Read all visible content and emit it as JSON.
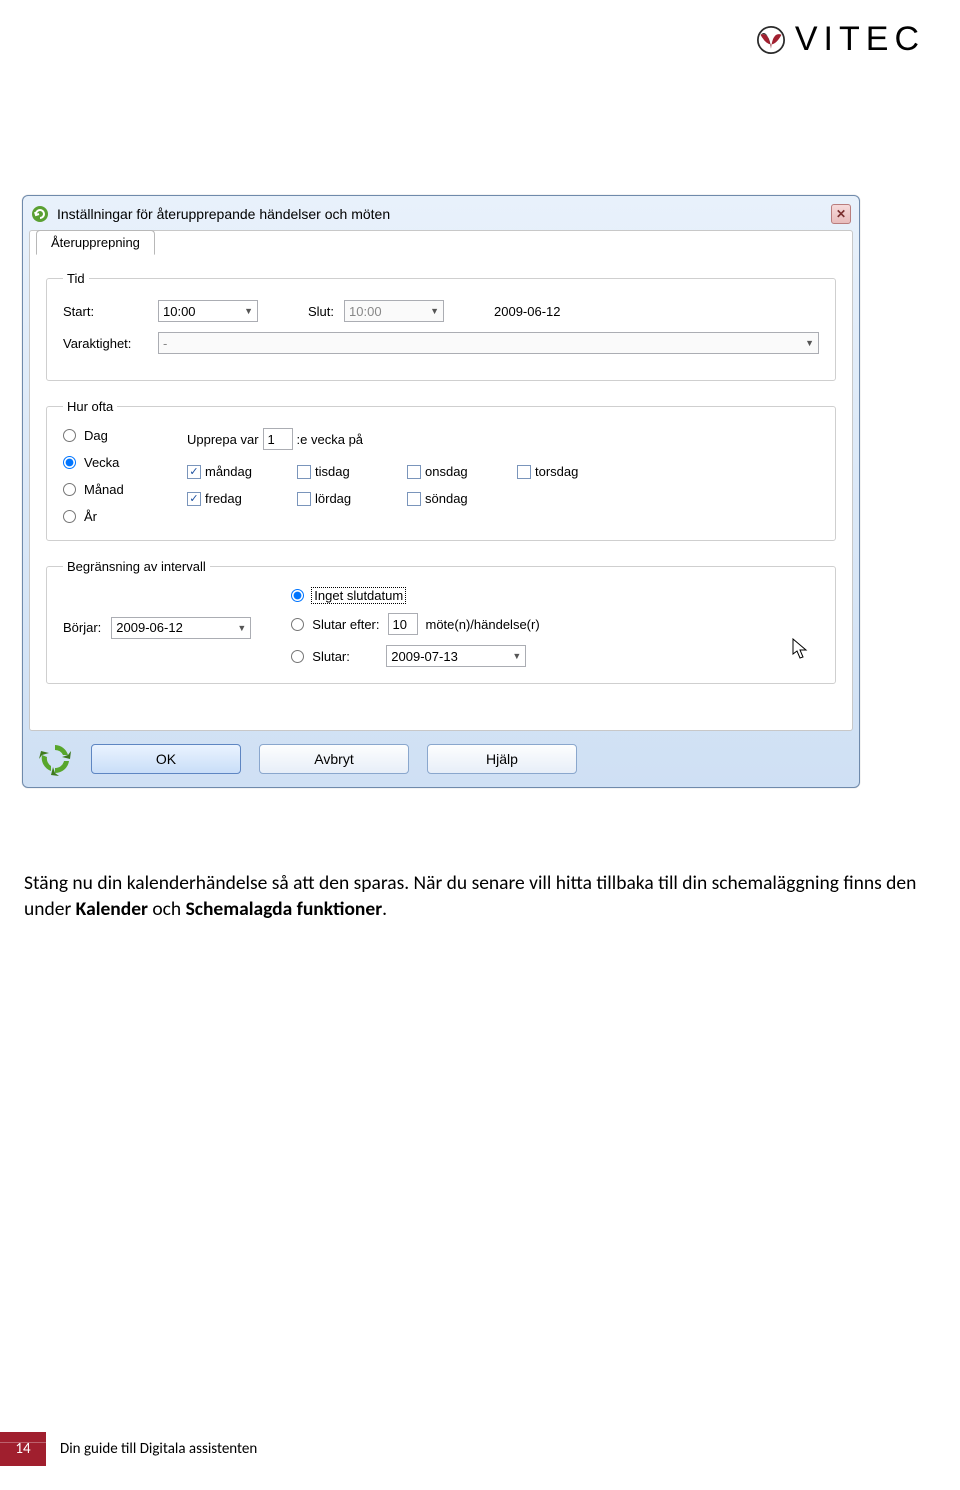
{
  "logo": {
    "text": "VITEC"
  },
  "dialog": {
    "title": "Inställningar för återupprepande händelser och möten",
    "tab_label": "Återupprepning",
    "time_group": {
      "legend": "Tid",
      "start_label": "Start:",
      "start_value": "10:00",
      "end_label": "Slut:",
      "end_value": "10:00",
      "date": "2009-06-12",
      "duration_label": "Varaktighet:",
      "duration_value": "-"
    },
    "freq_group": {
      "legend": "Hur ofta",
      "options": {
        "day": "Dag",
        "week": "Vecka",
        "month": "Månad",
        "year": "År"
      },
      "selected": "week",
      "repeat_prefix": "Upprepa var",
      "repeat_n": "1",
      "repeat_suffix": ":e vecka på",
      "days": {
        "mon": "måndag",
        "tue": "tisdag",
        "wed": "onsdag",
        "thu": "torsdag",
        "fri": "fredag",
        "sat": "lördag",
        "sun": "söndag"
      },
      "checked": [
        "mon",
        "fri"
      ]
    },
    "range_group": {
      "legend": "Begränsning av intervall",
      "begin_label": "Börjar:",
      "begin_value": "2009-06-12",
      "no_end": "Inget slutdatum",
      "end_after_label": "Slutar efter:",
      "end_after_n": "10",
      "end_after_suffix": "möte(n)/händelse(r)",
      "end_by_label": "Slutar:",
      "end_by_value": "2009-07-13",
      "selected": "no_end"
    },
    "buttons": {
      "ok": "OK",
      "cancel": "Avbryt",
      "help": "Hjälp"
    }
  },
  "body_text": {
    "part1": "Stäng nu din kalenderhändelse så att den sparas. När du senare vill hitta tillbaka till din schemaläggning finns den under ",
    "bold1": "Kalender",
    "mid": " och ",
    "bold2": "Schemalagda funktioner",
    "tail": "."
  },
  "footer": {
    "page": "14",
    "title": "Din guide till Digitala assistenten"
  }
}
